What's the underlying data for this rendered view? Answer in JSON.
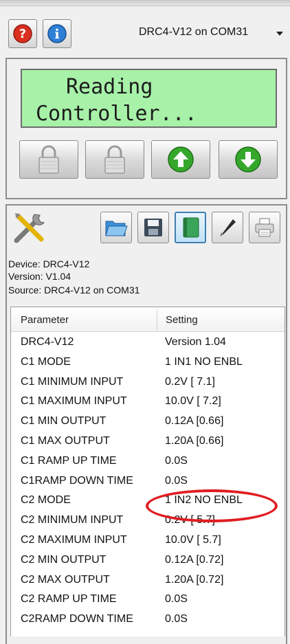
{
  "toolbar": {
    "help_icon": "question-mark-icon",
    "info_icon": "info-icon",
    "port_value": "DRC4-V12 on COM31"
  },
  "display": {
    "line1": "Reading",
    "line2": "Controller...",
    "background_color": "#a7f2a8"
  },
  "controls": {
    "buttons": [
      "lock-icon",
      "lock-icon",
      "green-up-arrow-icon",
      "green-down-arrow-icon"
    ]
  },
  "file_toolbar": {
    "icons": [
      "tools-icon",
      "open-folder-icon",
      "save-disk-icon",
      "book-icon",
      "pencil-icon",
      "printer-icon"
    ]
  },
  "device_info": {
    "device": "Device: DRC4-V12",
    "version": "Version: V1.04",
    "source": "Source: DRC4-V12 on COM31"
  },
  "parameters": {
    "header_parameter": "Parameter",
    "header_setting": "Setting",
    "rows": [
      {
        "parameter": "DRC4-V12",
        "setting": "Version 1.04"
      },
      {
        "parameter": "C1 MODE",
        "setting": "1 IN1 NO ENBL"
      },
      {
        "parameter": "C1 MINIMUM INPUT",
        "setting": "0.2V [  7.1]"
      },
      {
        "parameter": "C1 MAXIMUM INPUT",
        "setting": "10.0V [  7.2]"
      },
      {
        "parameter": "C1 MIN OUTPUT",
        "setting": "0.12A [0.66]"
      },
      {
        "parameter": "C1 MAX OUTPUT",
        "setting": "1.20A [0.66]"
      },
      {
        "parameter": "C1 RAMP UP TIME",
        "setting": "0.0S"
      },
      {
        "parameter": "C1RAMP DOWN TIME",
        "setting": "0.0S"
      },
      {
        "parameter": "C2 MODE",
        "setting": "1 IN2 NO ENBL"
      },
      {
        "parameter": "C2 MINIMUM INPUT",
        "setting": "0.2V [  5.7]"
      },
      {
        "parameter": "C2 MAXIMUM INPUT",
        "setting": "10.0V [  5.7]"
      },
      {
        "parameter": "C2 MIN OUTPUT",
        "setting": "0.12A [0.72]"
      },
      {
        "parameter": "C2 MAX OUTPUT",
        "setting": "1.20A [0.72]"
      },
      {
        "parameter": "C2 RAMP UP TIME",
        "setting": "0.0S"
      },
      {
        "parameter": "C2RAMP DOWN TIME",
        "setting": "0.0S"
      }
    ]
  },
  "annotation": {
    "highlighted_row": "C2 MODE",
    "color": "#e01d22"
  }
}
